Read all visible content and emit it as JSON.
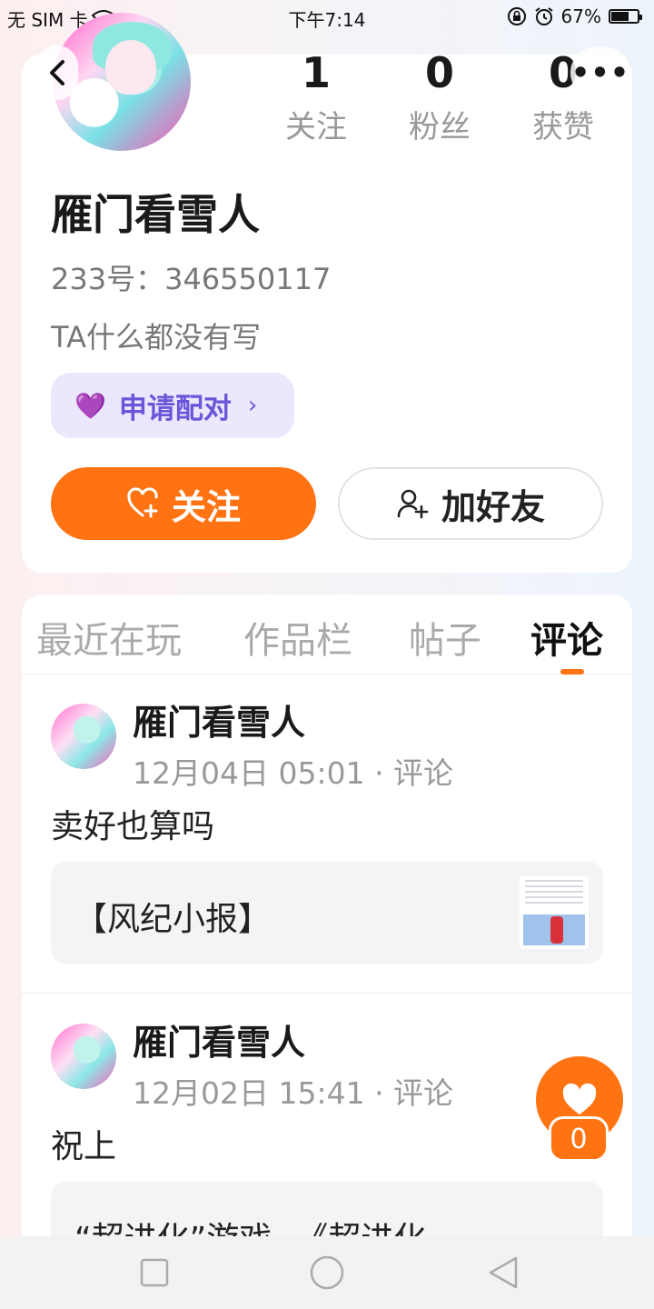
{
  "status_bar": {
    "carrier": "无 SIM 卡",
    "time": "下午7:14",
    "battery": "67%",
    "battery_level": 0.67
  },
  "profile": {
    "following_count": "1",
    "following_label": "关注",
    "followers_count": "0",
    "followers_label": "粉丝",
    "likes_count": "0",
    "likes_label": "获赞",
    "name": "雁门看雪人",
    "uid": "233号：346550117",
    "bio": "TA什么都没有写",
    "match_label": "申请配对",
    "follow_label": "关注",
    "add_friend_label": "加好友"
  },
  "tabs": [
    {
      "label": "最近在玩",
      "active": false
    },
    {
      "label": "作品栏",
      "active": false
    },
    {
      "label": "帖子",
      "active": false
    },
    {
      "label": "评论",
      "active": true
    }
  ],
  "posts": [
    {
      "author": "雁门看雪人",
      "meta": "12月04日 05:01 · 评论",
      "text": "卖好也算吗",
      "ref_title": "【风纪小报】"
    },
    {
      "author": "雁门看雪人",
      "meta": "12月02日 15:41 · 评论",
      "text": "祝上",
      "ref_title": "“超进化”游戏--《超进化"
    }
  ],
  "like_fab": {
    "count": "0"
  },
  "colors": {
    "accent": "#ff7312",
    "match_bg": "#ebe7fd",
    "match_text": "#6b55d8"
  }
}
